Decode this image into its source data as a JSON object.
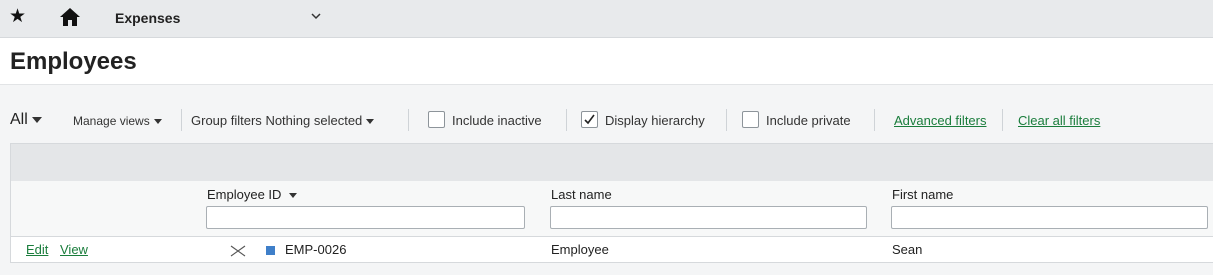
{
  "topbar": {
    "star_icon": "star-icon",
    "home_icon": "home-icon",
    "module": "Expenses",
    "chevron_icon": "chevron-down-icon"
  },
  "page": {
    "title": "Employees"
  },
  "filters": {
    "view": "All",
    "manage_views": "Manage views",
    "group_filters_label": "Group filters",
    "group_filters_value": "Nothing selected",
    "include_inactive": {
      "label": "Include inactive",
      "checked": false
    },
    "display_hierarchy": {
      "label": "Display hierarchy",
      "checked": true
    },
    "include_private": {
      "label": "Include private",
      "checked": false
    },
    "advanced_filters": "Advanced filters",
    "clear_all_filters": "Clear all filters"
  },
  "table": {
    "columns": [
      {
        "label": "Employee ID",
        "sortable": true,
        "filter_value": ""
      },
      {
        "label": "Last name",
        "filter_value": ""
      },
      {
        "label": "First name",
        "filter_value": ""
      }
    ],
    "rows": [
      {
        "edit": "Edit",
        "view": "View",
        "employee_id": "EMP-0026",
        "last_name": "Employee",
        "first_name": "Sean"
      }
    ]
  },
  "colors": {
    "link": "#1a7d3c",
    "hierarchy_node": "#3f7fc9",
    "topbar_bg": "#e8eaec"
  }
}
